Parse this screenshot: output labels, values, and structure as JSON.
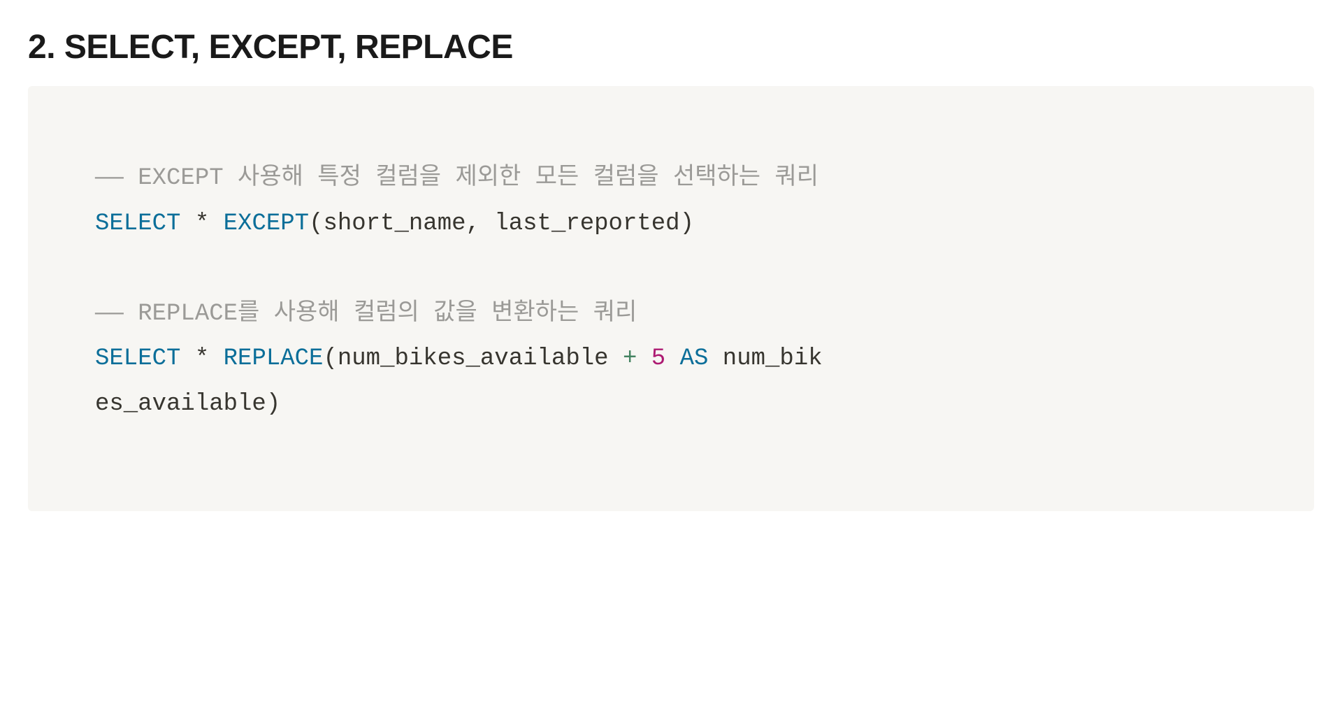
{
  "heading": "2. SELECT, EXCEPT, REPLACE",
  "code": {
    "comment1_prefix": "—— ",
    "comment1_body": "EXCEPT 사용해 특정 컬럼을 제외한 모든 컬럼을 선택하는 쿼리",
    "kw_select1": "SELECT",
    "star1": " * ",
    "kw_except": "EXCEPT",
    "paren_open1": "(",
    "ident_short_name": "short_name",
    "comma1": ", ",
    "ident_last_reported": "last_reported",
    "paren_close1": ")",
    "comment2_prefix": "—— ",
    "comment2_body": "REPLACE를 사용해 컬럼의 값을 변환하는 쿼리",
    "kw_select2": "SELECT",
    "star2": " * ",
    "kw_replace": "REPLACE",
    "paren_open2": "(",
    "ident_num_bikes_a": "num_bikes_available ",
    "op_plus": "+",
    "space_before_num": " ",
    "num_five": "5",
    "space_after_num": " ",
    "kw_as": "AS",
    "space_after_as": " ",
    "ident_num_bik": "num_bik",
    "ident_es_available": "es_available",
    "paren_close2": ")"
  }
}
